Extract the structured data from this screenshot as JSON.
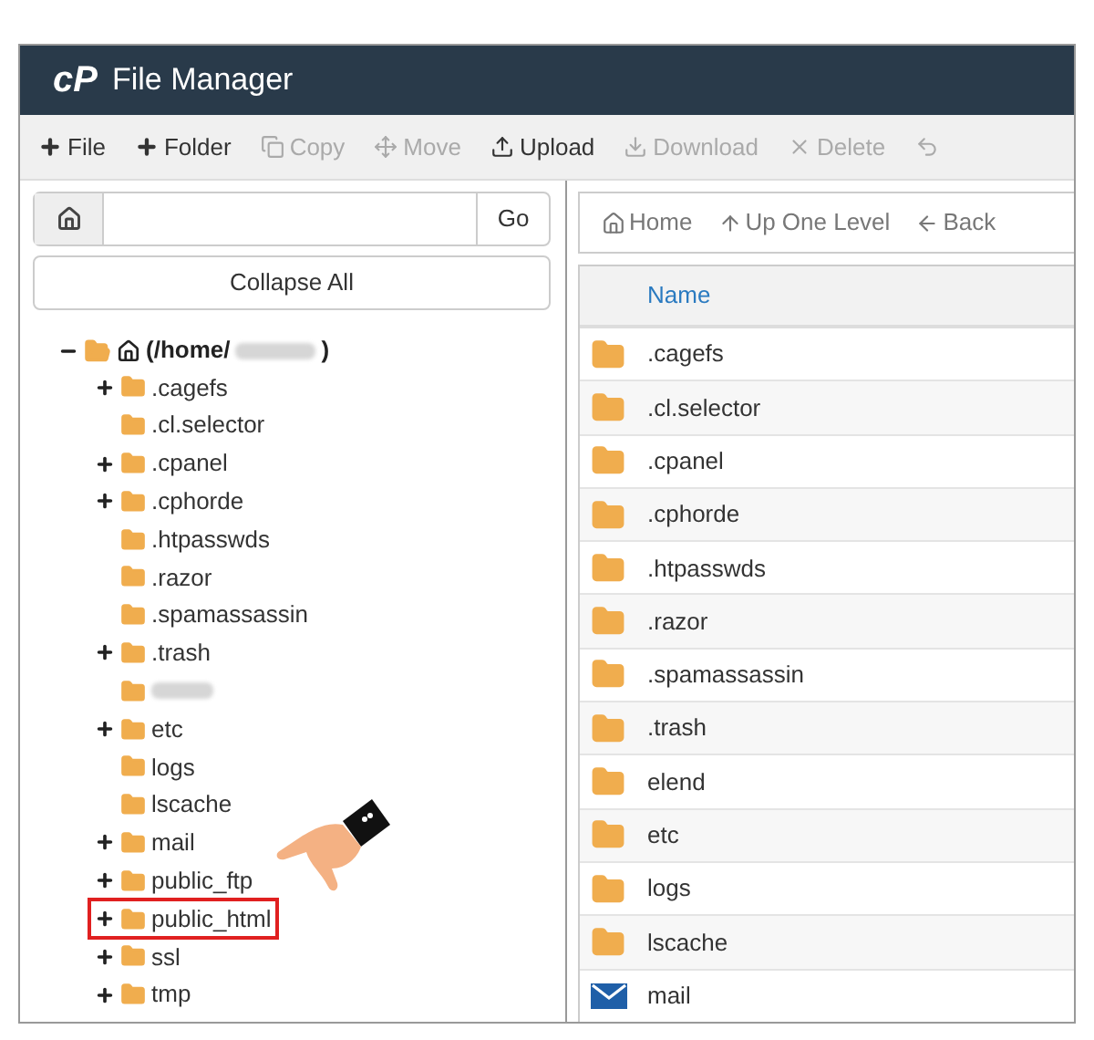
{
  "header": {
    "logo": "cP",
    "title": "File Manager"
  },
  "toolbar": [
    {
      "label": "File",
      "kind": "plus",
      "disabled": false
    },
    {
      "label": "Folder",
      "kind": "plus",
      "disabled": false
    },
    {
      "label": "Copy",
      "kind": "copy",
      "disabled": true
    },
    {
      "label": "Move",
      "kind": "move",
      "disabled": true
    },
    {
      "label": "Upload",
      "kind": "upload",
      "disabled": false
    },
    {
      "label": "Download",
      "kind": "download",
      "disabled": true
    },
    {
      "label": "Delete",
      "kind": "delete",
      "disabled": true
    },
    {
      "kind": "restore",
      "disabled": true
    }
  ],
  "path_bar": {
    "button": "Go"
  },
  "collapse_button": "Collapse All",
  "nav": [
    {
      "label": "Home",
      "kind": "home"
    },
    {
      "label": "Up One Level",
      "kind": "up"
    },
    {
      "label": "Back",
      "kind": "back"
    }
  ],
  "tree": {
    "label_start": "(/home/",
    "label_end": ")",
    "expanded": true,
    "children": [
      {
        "label": ".cagefs",
        "expandable": true,
        "highlighted": false
      },
      {
        "label": ".cl.selector",
        "expandable": false,
        "highlighted": false
      },
      {
        "label": ".cpanel",
        "expandable": true,
        "highlighted": false
      },
      {
        "label": ".cphorde",
        "expandable": true,
        "highlighted": false
      },
      {
        "label": ".htpasswds",
        "expandable": false,
        "highlighted": false
      },
      {
        "label": ".razor",
        "expandable": false,
        "highlighted": false
      },
      {
        "label": ".spamassassin",
        "expandable": false,
        "highlighted": false
      },
      {
        "label": ".trash",
        "expandable": true,
        "highlighted": false
      },
      {
        "kind": "redacted",
        "expandable": false,
        "highlighted": false
      },
      {
        "label": "etc",
        "expandable": true,
        "highlighted": false
      },
      {
        "label": "logs",
        "expandable": false,
        "highlighted": false
      },
      {
        "label": "lscache",
        "expandable": false,
        "highlighted": false
      },
      {
        "label": "mail",
        "expandable": true,
        "highlighted": false
      },
      {
        "label": "public_ftp",
        "expandable": true,
        "highlighted": false
      },
      {
        "label": "public_html",
        "expandable": true,
        "highlighted": true
      },
      {
        "label": "ssl",
        "expandable": true,
        "highlighted": false
      },
      {
        "label": "tmp",
        "expandable": true,
        "highlighted": false
      }
    ]
  },
  "table": {
    "columns": [
      "Name"
    ],
    "rows": [
      {
        "kind": "folder",
        "name": ".cagefs"
      },
      {
        "kind": "folder",
        "name": ".cl.selector"
      },
      {
        "kind": "folder",
        "name": ".cpanel"
      },
      {
        "kind": "folder",
        "name": ".cphorde"
      },
      {
        "kind": "folder",
        "name": ".htpasswds"
      },
      {
        "kind": "folder",
        "name": ".razor"
      },
      {
        "kind": "folder",
        "name": ".spamassassin"
      },
      {
        "kind": "folder",
        "name": ".trash"
      },
      {
        "kind": "folder",
        "name": "elend"
      },
      {
        "kind": "folder",
        "name": "etc"
      },
      {
        "kind": "folder",
        "name": "logs"
      },
      {
        "kind": "folder",
        "name": "lscache"
      },
      {
        "kind": "mail",
        "name": "mail"
      }
    ]
  }
}
